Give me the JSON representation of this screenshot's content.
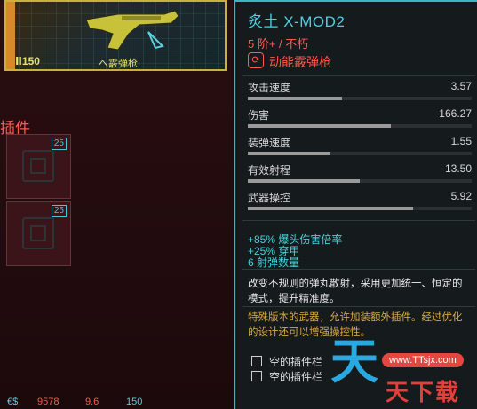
{
  "weapon_card": {
    "tier_badge": "Ⅱ150",
    "type_label": "へ霰弹枪"
  },
  "plugins": {
    "title": "插件",
    "slots": [
      {
        "level": "25"
      },
      {
        "level": "25"
      }
    ]
  },
  "detail": {
    "name": "炙土 X-MOD2",
    "rarity": "5 阶+ / 不朽",
    "weapon_type_icon": "smart-weapon-icon",
    "weapon_type": "动能霰弹枪",
    "stats": [
      {
        "label": "攻击速度",
        "value": "3.57",
        "fill_fraction": 0.42
      },
      {
        "label": "伤害",
        "value": "166.27",
        "fill_fraction": 0.64
      },
      {
        "label": "装弹速度",
        "value": "1.55",
        "fill_fraction": 0.37
      },
      {
        "label": "有效射程",
        "value": "13.50",
        "fill_fraction": 0.5
      },
      {
        "label": "武器操控",
        "value": "5.92",
        "fill_fraction": 0.74
      }
    ],
    "bonuses": [
      "+85% 爆头伤害倍率",
      "+25% 穿甲",
      "6 射弹数量"
    ],
    "description": "改变不规则的弹丸散射，采用更加统一、恒定的模式，提升精准度。",
    "special": "特殊版本的武器，允许加装额外插件。经过优化的设计还可以增强操控性。",
    "mod_slots": [
      {
        "label": "空的插件栏"
      },
      {
        "label": "空的插件栏"
      }
    ]
  },
  "footer": {
    "money_label": "€$",
    "money": "9578",
    "weight": "9.6",
    "weight2": "150"
  },
  "watermark": {
    "big_char": "天",
    "badge": "www.TTsjx.com",
    "text": "天下载"
  },
  "colors": {
    "accent_cyan": "#47d3e0",
    "accent_red": "#ff5a4e",
    "accent_gold": "#d9a93a"
  }
}
